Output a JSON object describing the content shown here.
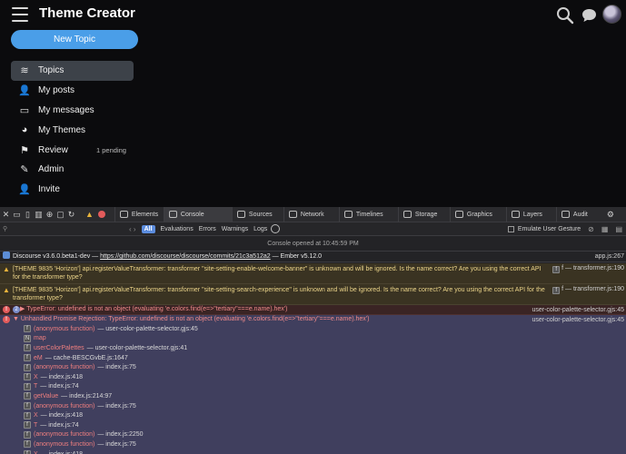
{
  "app": {
    "title": "Theme Creator",
    "new_topic": "New Topic",
    "nav": [
      {
        "label": "Topics",
        "icon": "layers-icon",
        "glyph": "≋",
        "active": true,
        "badge": ""
      },
      {
        "label": "My posts",
        "icon": "user-icon",
        "glyph": "👤",
        "active": false,
        "badge": ""
      },
      {
        "label": "My messages",
        "icon": "inbox-icon",
        "glyph": "▭",
        "active": false,
        "badge": ""
      },
      {
        "label": "My Themes",
        "icon": "palette-icon",
        "glyph": "◕",
        "active": false,
        "badge": ""
      },
      {
        "label": "Review",
        "icon": "flag-icon",
        "glyph": "⚑",
        "active": false,
        "badge": "1 pending"
      },
      {
        "label": "Admin",
        "icon": "wrench-icon",
        "glyph": "✎",
        "active": false,
        "badge": ""
      },
      {
        "label": "Invite",
        "icon": "user-plus-icon",
        "glyph": "👤",
        "active": false,
        "badge": ""
      }
    ]
  },
  "devtools": {
    "tabs": [
      "Elements",
      "Console",
      "Sources",
      "Network",
      "Timelines",
      "Storage",
      "Graphics",
      "Layers",
      "Audit"
    ],
    "active_tab": "Console",
    "warn_count": "",
    "filter_placeholder": "",
    "filters": [
      "All",
      "Evaluations",
      "Errors",
      "Warnings",
      "Logs"
    ],
    "emulate": "Emulate User Gesture",
    "opened": "Console opened at 10:45:59 PM",
    "info": {
      "prefix": "Discourse v3.6.0.beta1-dev — ",
      "link": "https://github.com/discourse/discourse/commits/21c3a512a2",
      "suffix": " — Ember v5.12.0",
      "source": "app.js:267"
    },
    "warn1": {
      "text": "[THEME 9835 'Horizon'] api.registerValueTransformer: transformer \"site-setting-enable-welcome-banner\" is unknown and will be ignored. Is the name correct? Are you using the correct API for the transformer type?",
      "source": "f — transformer.js:190"
    },
    "warn2": {
      "text": "[THEME 9835 'Horizon'] api.registerValueTransformer: transformer \"site-setting-search-experience\" is unknown and will be ignored. Is the name correct? Are you using the correct API for the transformer type?",
      "source": "f — transformer.js:190"
    },
    "err1": {
      "count": "2",
      "text": "TypeError: undefined is not an object (evaluating 'e.colors.find(e=>\"tertiary\"===e.name).hex')",
      "source": "user-color-palette-selector.gjs:45"
    },
    "err2": {
      "text": "Unhandled Promise Rejection: TypeError: undefined is not an object (evaluating 'e.colors.find(e=>\"tertiary\"===e.name).hex')",
      "source": "user-color-palette-selector.gjs:45",
      "stack": [
        {
          "badge": "f",
          "name": "(anonymous function)",
          "loc": "— user-color-palette-selector.gjs:45"
        },
        {
          "badge": "N",
          "name": "map",
          "loc": ""
        },
        {
          "badge": "f",
          "name": "userColorPalettes",
          "loc": "— user-color-palette-selector.gjs:41"
        },
        {
          "badge": "f",
          "name": "eM",
          "loc": "— cache-BESCGvbE.js:1647"
        },
        {
          "badge": "f",
          "name": "(anonymous function)",
          "loc": "— index.js:75"
        },
        {
          "badge": "f",
          "name": "X",
          "loc": "— index.js:418"
        },
        {
          "badge": "f",
          "name": "T",
          "loc": "— index.js:74"
        },
        {
          "badge": "f",
          "name": "getValue",
          "loc": "— index.js:214:97"
        },
        {
          "badge": "f",
          "name": "(anonymous function)",
          "loc": "— index.js:75"
        },
        {
          "badge": "f",
          "name": "X",
          "loc": "— index.js:418"
        },
        {
          "badge": "f",
          "name": "T",
          "loc": "— index.js:74"
        },
        {
          "badge": "f",
          "name": "(anonymous function)",
          "loc": "— index.js:2250"
        },
        {
          "badge": "f",
          "name": "(anonymous function)",
          "loc": "— index.js:75"
        },
        {
          "badge": "f",
          "name": "X",
          "loc": "— index.js:418"
        }
      ]
    }
  }
}
